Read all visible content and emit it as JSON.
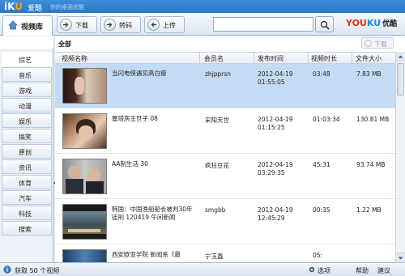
{
  "titlebar": {
    "logo_i": "i",
    "logo_k": "K",
    "logo_u": "U",
    "app_name": "爱酷",
    "slogan": "你的桌面优酷"
  },
  "toolbar": {
    "library_tab": "视频库",
    "download": "下载",
    "transcode": "转码",
    "upload": "上传",
    "search_placeholder": "",
    "brand_y": "YOU",
    "brand_o": "KU",
    "brand_cn": "优酷"
  },
  "sidebar": {
    "all": "全部",
    "items": [
      {
        "label": "综艺"
      },
      {
        "label": "音乐"
      },
      {
        "label": "游戏"
      },
      {
        "label": "动漫"
      },
      {
        "label": "娱乐"
      },
      {
        "label": "搞笑"
      },
      {
        "label": "原创"
      },
      {
        "label": "资讯"
      },
      {
        "label": "体育"
      },
      {
        "label": "汽车"
      },
      {
        "label": "科技"
      },
      {
        "label": "搜索"
      }
    ]
  },
  "main": {
    "title": "全部",
    "download_label": "下载",
    "columns": [
      "视频名称",
      "会员名",
      "发布时间",
      "视频时长",
      "文件大小"
    ]
  },
  "videos": [
    {
      "title": "当闪电侠遇见高白瘦",
      "user": "zhjpprsn",
      "date": "2012-04-19",
      "time": "01:55:05",
      "duration": "03:48",
      "size": "7.83 MB"
    },
    {
      "title": "屋塔房王世子 08",
      "user": "宋阳天世",
      "date": "2012-04-19",
      "time": "01:15:25",
      "duration": "01:03:34",
      "size": "130.81 MB"
    },
    {
      "title": "AA制生活 30",
      "user": "疯狂豆花",
      "date": "2012-04-19",
      "time": "03:29:35",
      "duration": "45:31",
      "size": "93.74 MB"
    },
    {
      "title": "韩国：中国渔船船长被判30年徒刑 120419 午间新闻",
      "user": "smgbb",
      "date": "2012-04-19",
      "time": "12:45:29",
      "duration": "00:35",
      "size": "1.22 MB"
    },
    {
      "title": "西安欧亚学院 新闻系《最",
      "user": "宁玉鑫",
      "date": "",
      "time": "",
      "duration": "05:",
      "size": ""
    }
  ],
  "statusbar": {
    "count_text": "获取 50 个视频",
    "options": "选项",
    "help": "帮助",
    "suggest": "建议"
  }
}
